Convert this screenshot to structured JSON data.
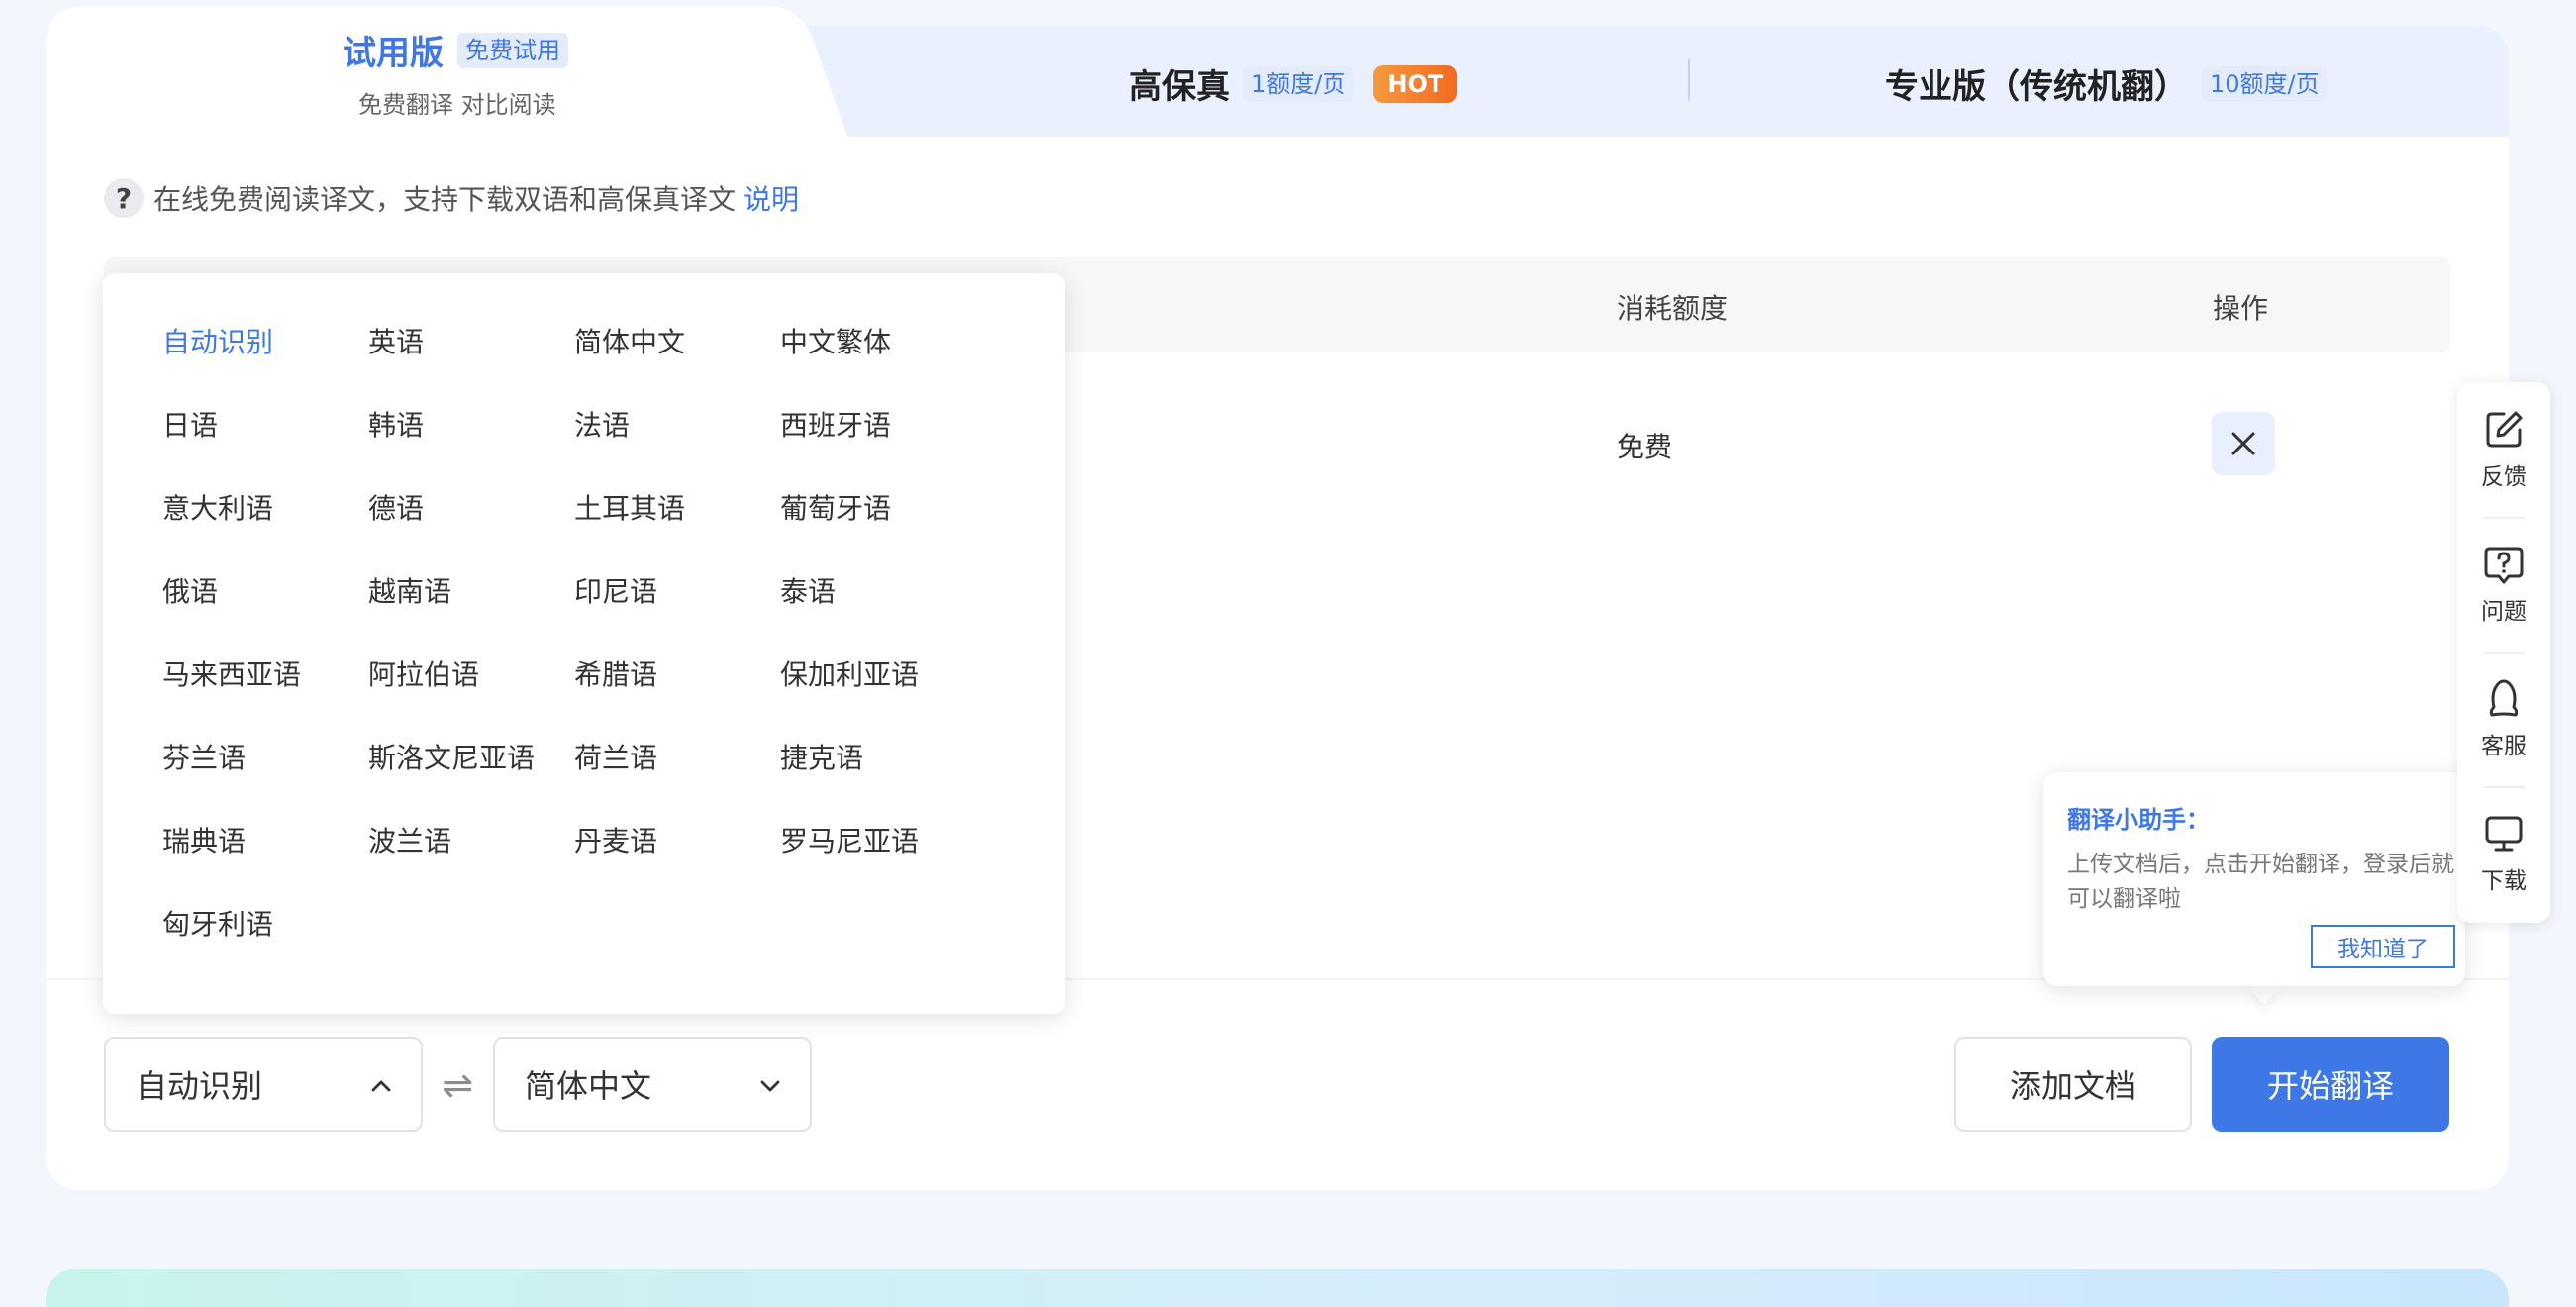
{
  "tabs": {
    "trial": {
      "title": "试用版",
      "badge": "免费试用",
      "subtitle": "免费翻译 对比阅读"
    },
    "high_fidelity": {
      "title": "高保真",
      "badge": "1额度/页",
      "hot": "HOT"
    },
    "pro": {
      "title": "专业版（传统机翻）",
      "badge": "10额度/页"
    }
  },
  "info": {
    "icon": "question-icon",
    "icon_glyph": "?",
    "text": "在线免费阅读译文，支持下载双语和高保真译文",
    "link": "说明"
  },
  "table": {
    "headers": {
      "cost": "消耗额度",
      "action": "操作"
    },
    "rows": [
      {
        "cost": "免费"
      }
    ]
  },
  "languages": {
    "selected": "自动识别",
    "items": [
      "自动识别",
      "英语",
      "简体中文",
      "中文繁体",
      "日语",
      "韩语",
      "法语",
      "西班牙语",
      "意大利语",
      "德语",
      "土耳其语",
      "葡萄牙语",
      "俄语",
      "越南语",
      "印尼语",
      "泰语",
      "马来西亚语",
      "阿拉伯语",
      "希腊语",
      "保加利亚语",
      "芬兰语",
      "斯洛文尼亚语",
      "荷兰语",
      "捷克语",
      "瑞典语",
      "波兰语",
      "丹麦语",
      "罗马尼亚语",
      "匈牙利语"
    ]
  },
  "controls": {
    "source_lang": "自动识别",
    "target_lang": "简体中文",
    "swap_glyph": "⇌",
    "add_doc": "添加文档",
    "start": "开始翻译"
  },
  "helper": {
    "title": "翻译小助手：",
    "body": "上传文档后，点击开始翻译，登录后就可以翻译啦",
    "button": "我知道了"
  },
  "side_bar": {
    "items": [
      {
        "icon": "edit-icon",
        "label": "反馈"
      },
      {
        "icon": "question-chat-icon",
        "label": "问题"
      },
      {
        "icon": "service-icon",
        "label": "客服"
      },
      {
        "icon": "monitor-icon",
        "label": "下载"
      }
    ]
  },
  "colors": {
    "accent": "#3e78e7",
    "hot_start": "#f59a3e",
    "hot_end": "#f26a21",
    "page_bg": "#f3f6fd"
  }
}
